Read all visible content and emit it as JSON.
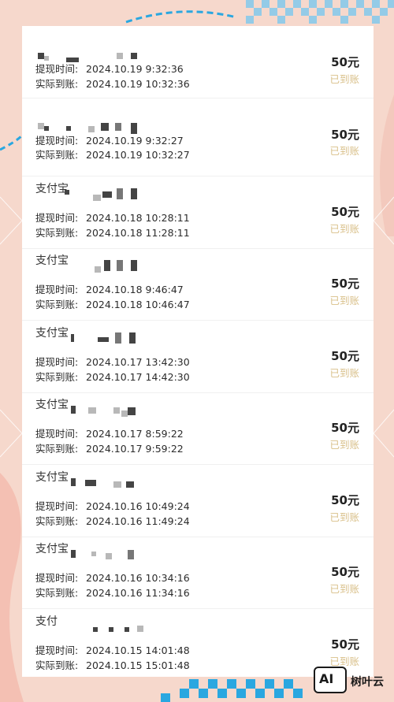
{
  "labels": {
    "withdraw_time": "提现时间:",
    "arrive_time": "实际到账:"
  },
  "records": [
    {
      "name": "",
      "withdraw": "2024.10.19 9:32:36",
      "arrive": "2024.10.19 10:32:36",
      "amount": "50元",
      "status": "已到账"
    },
    {
      "name": "",
      "withdraw": "2024.10.19 9:32:27",
      "arrive": "2024.10.19 10:32:27",
      "amount": "50元",
      "status": "已到账"
    },
    {
      "name": "支付宝",
      "withdraw": "2024.10.18 10:28:11",
      "arrive": "2024.10.18 11:28:11",
      "amount": "50元",
      "status": "已到账"
    },
    {
      "name": "支付宝",
      "withdraw": "2024.10.18 9:46:47",
      "arrive": "2024.10.18 10:46:47",
      "amount": "50元",
      "status": "已到账"
    },
    {
      "name": "支付宝",
      "withdraw": "2024.10.17 13:42:30",
      "arrive": "2024.10.17 14:42:30",
      "amount": "50元",
      "status": "已到账"
    },
    {
      "name": "支付宝",
      "withdraw": "2024.10.17 8:59:22",
      "arrive": "2024.10.17 9:59:22",
      "amount": "50元",
      "status": "已到账"
    },
    {
      "name": "支付宝",
      "withdraw": "2024.10.16 10:49:24",
      "arrive": "2024.10.16 11:49:24",
      "amount": "50元",
      "status": "已到账"
    },
    {
      "name": "支付宝",
      "withdraw": "2024.10.16 10:34:16",
      "arrive": "2024.10.16 11:34:16",
      "amount": "50元",
      "status": "已到账"
    },
    {
      "name": "支付",
      "withdraw": "2024.10.15 14:01:48",
      "arrive": "2024.10.15 15:01:48",
      "amount": "50元",
      "status": "已到账"
    }
  ],
  "watermark": {
    "logo_text": "AI",
    "brand_text": "树叶云"
  },
  "colors": {
    "background": "#f6d8cc",
    "status_gold": "#d9c08a",
    "accent_blue": "#2aa7e0"
  }
}
